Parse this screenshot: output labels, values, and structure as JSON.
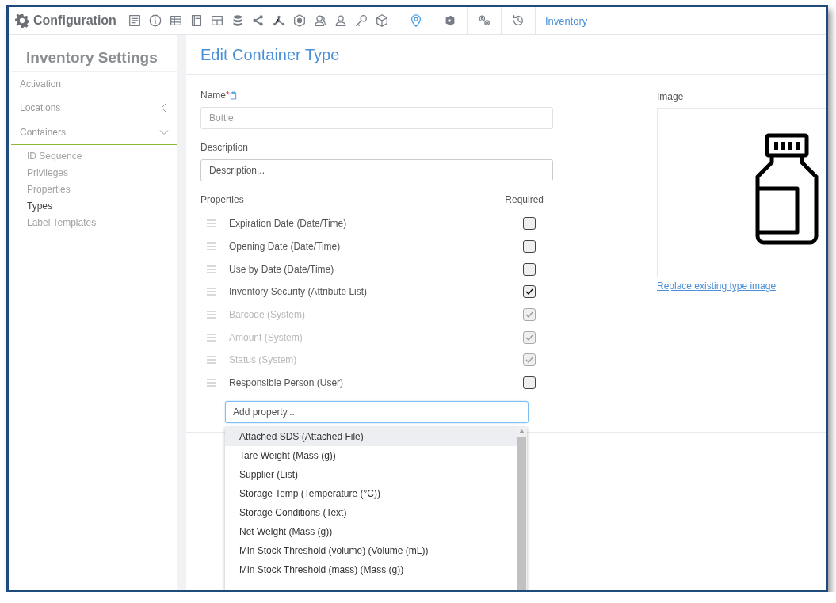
{
  "toolbar": {
    "title": "Configuration",
    "tools": [
      {
        "selected": false
      },
      {
        "selected": false
      },
      {
        "selected": false
      },
      {
        "selected": false
      },
      {
        "selected": false
      },
      {
        "selected": false
      },
      {
        "selected": false
      },
      {
        "selected": false
      },
      {
        "selected": false
      },
      {
        "selected": false
      },
      {
        "selected": false
      },
      {
        "selected": false
      },
      {
        "selected": false
      },
      {
        "selected": true
      },
      {
        "selected": false
      },
      {
        "selected": false
      },
      {
        "selected": false
      }
    ],
    "breadcrumb": "Inventory"
  },
  "sidebar": {
    "title": "Inventory Settings",
    "items": [
      {
        "label": "Activation"
      },
      {
        "label": "Locations",
        "expanded": false
      },
      {
        "label": "Containers",
        "expanded": true,
        "children": [
          {
            "label": "ID Sequence",
            "selected": false
          },
          {
            "label": "Privileges",
            "selected": false
          },
          {
            "label": "Properties",
            "selected": false
          },
          {
            "label": "Types",
            "selected": true
          },
          {
            "label": "Label Templates",
            "selected": false
          }
        ]
      }
    ]
  },
  "form": {
    "title": "Edit Container Type",
    "name_label": "Name",
    "required_mark": "*",
    "name_value": "Bottle",
    "description_label": "Description",
    "description_placeholder": "Description...",
    "properties_label": "Properties",
    "required_label": "Required",
    "properties": [
      {
        "label": "Expiration Date (Date/Time)",
        "required": false,
        "disabled": false
      },
      {
        "label": "Opening Date (Date/Time)",
        "required": false,
        "disabled": false
      },
      {
        "label": "Use by Date (Date/Time)",
        "required": false,
        "disabled": false
      },
      {
        "label": "Inventory Security (Attribute List)",
        "required": true,
        "disabled": false
      },
      {
        "label": "Barcode (System)",
        "required": true,
        "disabled": true
      },
      {
        "label": "Amount (System)",
        "required": true,
        "disabled": true
      },
      {
        "label": "Status (System)",
        "required": true,
        "disabled": true
      },
      {
        "label": "Responsible Person (User)",
        "required": false,
        "disabled": false
      }
    ],
    "add_placeholder": "Add property...",
    "options": [
      {
        "label": "Attached SDS (Attached File)",
        "selected": true
      },
      {
        "label": "Tare Weight (Mass (g))",
        "selected": false
      },
      {
        "label": "Supplier (List)",
        "selected": false
      },
      {
        "label": "Storage Temp (Temperature (°C))",
        "selected": false
      },
      {
        "label": "Storage Conditions (Text)",
        "selected": false
      },
      {
        "label": "Net Weight (Mass (g))",
        "selected": false
      },
      {
        "label": "Min Stock Threshold (volume) (Volume (mL))",
        "selected": false
      },
      {
        "label": "Min Stock Threshold (mass) (Mass (g))",
        "selected": false
      }
    ],
    "image_label": "Image",
    "replace_link": "Replace existing type image"
  }
}
